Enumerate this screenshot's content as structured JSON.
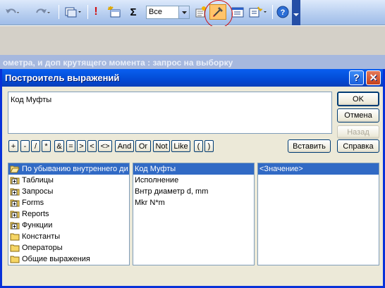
{
  "toolbar": {
    "filter_combo_value": "Все",
    "icons": [
      "undo-icon",
      "redo-icon",
      "view-icon",
      "exclamation-run-icon",
      "show-table-icon",
      "totals-sigma-icon",
      "properties-icon",
      "builder-icon",
      "database-window-icon",
      "new-object-icon",
      "help-icon"
    ],
    "sigma_label": "Σ",
    "exclamation_label": "!"
  },
  "background_window": {
    "title": "ометра, и доп крутящего момента : запрос на выборку"
  },
  "dialog": {
    "title": "Построитель выражений",
    "help_label": "?",
    "close_label": "✕",
    "expression_text": "Код Муфты",
    "buttons": {
      "ok": "OK",
      "cancel": "Отмена",
      "back": "Назад",
      "paste": "Вставить",
      "help": "Справка"
    },
    "operators": [
      "+",
      "-",
      "/",
      "*",
      "&",
      "=",
      ">",
      "<",
      "<>",
      "And",
      "Or",
      "Not",
      "Like",
      "(",
      ")"
    ],
    "left_list": [
      {
        "label": "По убыванию внутреннего ди",
        "icon": "open-folder-icon",
        "selected": true
      },
      {
        "label": "Таблицы",
        "icon": "plus-folder-icon"
      },
      {
        "label": "Запросы",
        "icon": "plus-folder-icon"
      },
      {
        "label": "Forms",
        "icon": "plus-folder-icon"
      },
      {
        "label": "Reports",
        "icon": "plus-folder-icon"
      },
      {
        "label": "Функции",
        "icon": "plus-folder-icon"
      },
      {
        "label": "Константы",
        "icon": "folder-icon"
      },
      {
        "label": "Операторы",
        "icon": "folder-icon"
      },
      {
        "label": "Общие выражения",
        "icon": "folder-icon"
      }
    ],
    "middle_list": [
      {
        "label": "Код Муфты",
        "selected": true
      },
      {
        "label": "Исполнение"
      },
      {
        "label": "Внтр диаметр d, mm"
      },
      {
        "label": "Mkr N*m"
      }
    ],
    "right_list": [
      {
        "label": "<Значение>",
        "selected": true
      }
    ]
  },
  "colors": {
    "title_blue": "#0a5ef0",
    "selection": "#316ac5",
    "dialog_face": "#ece9d8",
    "annotation_red": "#d01010"
  }
}
